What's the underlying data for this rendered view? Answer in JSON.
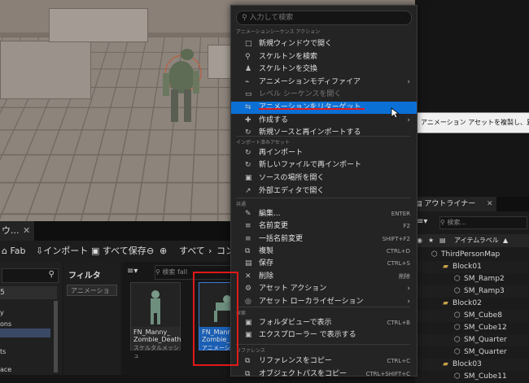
{
  "menu": {
    "search_placeholder": "入力して検索",
    "sections": {
      "animation_sequence_actions": "アニメーションシーケンス アクション",
      "import_assets": "インポート済みアセット",
      "common": "共通",
      "explore": "探索",
      "references": "リファレンス"
    },
    "items": [
      {
        "icon": "new-window-icon",
        "label": "新規ウィンドウで開く"
      },
      {
        "icon": "search-icon",
        "label": "スケルトンを検索"
      },
      {
        "icon": "skeleton-icon",
        "label": "スケルトンを交換"
      },
      {
        "icon": "modifier-icon",
        "label": "アニメーションモディファイア",
        "submenu": true
      },
      {
        "icon": "sequence-icon",
        "label": "レベル シーケンスを開く",
        "disabled": true
      },
      {
        "icon": "retarget-icon",
        "label": "アニメーションをリターゲット",
        "highlighted": true
      },
      {
        "icon": "create-icon",
        "label": "作成する",
        "submenu": true
      },
      {
        "icon": "reimport-icon",
        "label": "新規ソースと再インポートする"
      },
      {
        "icon": "reimport-icon",
        "label": "再インポート"
      },
      {
        "icon": "reimport-icon",
        "label": "新しいファイルで再インポート"
      },
      {
        "icon": "folder-icon",
        "label": "ソースの場所を開く"
      },
      {
        "icon": "external-icon",
        "label": "外部エディタで開く"
      },
      {
        "icon": "edit-icon",
        "label": "編集...",
        "shortcut": "ENTER"
      },
      {
        "icon": "rename-icon",
        "label": "名前変更",
        "shortcut": "F2"
      },
      {
        "icon": "rename-icon",
        "label": "一括名前変更",
        "shortcut": "SHIFT+F2"
      },
      {
        "icon": "duplicate-icon",
        "label": "複製",
        "shortcut": "CTRL+D"
      },
      {
        "icon": "save-icon",
        "label": "保存",
        "shortcut": "CTRL+S"
      },
      {
        "icon": "delete-icon",
        "label": "削除",
        "shortcut": "削除"
      },
      {
        "icon": "asset-action-icon",
        "label": "アセット アクション",
        "submenu": true
      },
      {
        "icon": "localize-icon",
        "label": "アセット ローカライゼーション",
        "submenu": true
      },
      {
        "icon": "folder-icon",
        "label": "フォルダビューで表示",
        "shortcut": "CTRL+B"
      },
      {
        "icon": "folder-icon",
        "label": "エクスプローラー で表示する"
      },
      {
        "icon": "copy-icon",
        "label": "リファレンスをコピー",
        "shortcut": "CTRL+C"
      },
      {
        "icon": "copy-icon",
        "label": "オブジェクトパスをコピー",
        "shortcut": "CTRL+SHIFT+C"
      }
    ]
  },
  "tooltip": "アニメーション アセットを複製し、異な",
  "content_browser": {
    "tab_label": "ウ...",
    "toolbar": {
      "fab": "Fab",
      "import": "インポート",
      "save_all": "すべて保存",
      "all": "すべて",
      "path_tail": "コン"
    },
    "filters_label": "フィルタ",
    "filter_chip": "アニメーショ",
    "search_placeholder": "検索 fall",
    "left_panel": {
      "item1": "5",
      "item2": "y",
      "item3": "ons",
      "item4": "ts",
      "item5": "ace"
    },
    "assets": [
      {
        "name": "FN_Manny_\nZombie_Death",
        "type": "スケルタルメッシュ"
      },
      {
        "name": "FN_Manny_\nZombie_D",
        "type": "アニメーション"
      }
    ]
  },
  "outliner": {
    "title": "アウトライナー",
    "search_placeholder": "検索...",
    "column": "アイテムラベル",
    "rows": [
      {
        "label": "ThirdPersonMap",
        "indent": 0,
        "folder": false
      },
      {
        "label": "Block01",
        "indent": 1,
        "folder": true
      },
      {
        "label": "SM_Ramp2",
        "indent": 2,
        "folder": false
      },
      {
        "label": "SM_Ramp3",
        "indent": 2,
        "folder": false
      },
      {
        "label": "Block02",
        "indent": 1,
        "folder": true
      },
      {
        "label": "SM_Cube8",
        "indent": 2,
        "folder": false
      },
      {
        "label": "SM_Cube12",
        "indent": 2,
        "folder": false
      },
      {
        "label": "SM_Quarter",
        "indent": 2,
        "folder": false
      },
      {
        "label": "SM_Quarter",
        "indent": 2,
        "folder": false
      },
      {
        "label": "Block03",
        "indent": 1,
        "folder": true
      },
      {
        "label": "SM_Cube11",
        "indent": 2,
        "folder": false
      }
    ]
  },
  "colors": {
    "highlight": "#0b70d6",
    "menu_bg": "#242424",
    "red_box": "#e21818"
  }
}
